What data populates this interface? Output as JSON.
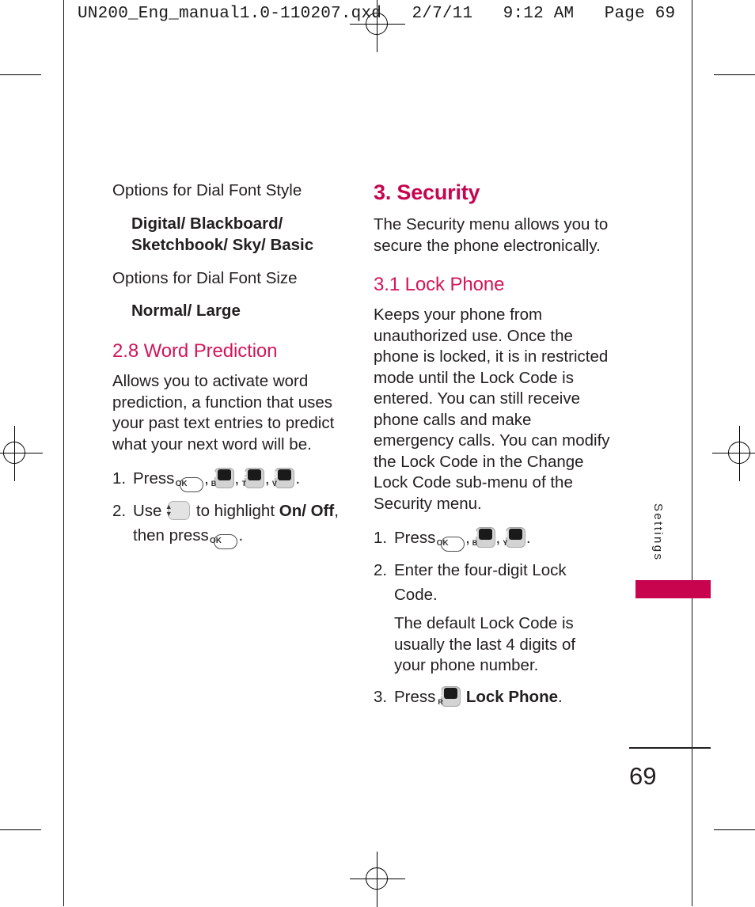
{
  "print_header": "UN200_Eng_manual1.0-110207.qxd   2/7/11   9:12 AM   Page 69",
  "colors": {
    "accent_crimson": "#c8044f",
    "heading_minor": "#d2165b",
    "body_text": "#231f20"
  },
  "left_column": {
    "dial_font_style_label": "Options for Dial Font Style",
    "dial_font_style_values": "Digital/ Blackboard/ Sketchbook/ Sky/ Basic",
    "dial_font_size_label": "Options for Dial Font Size",
    "dial_font_size_values": "Normal/ Large",
    "word_prediction_heading": "2.8 Word Prediction",
    "word_prediction_body": "Allows you to activate word prediction, a function that uses your past text entries to predict what your next word will be.",
    "steps": [
      {
        "number": "1.",
        "text_before": "Press",
        "keys": [
          {
            "type": "ok",
            "label": "OK"
          },
          {
            "type": "numeric",
            "digit": "9",
            "letter": "B"
          },
          {
            "type": "numeric",
            "digit": "2",
            "letter": "T"
          },
          {
            "type": "numeric",
            "digit": "8",
            "letter": "V"
          }
        ],
        "separators": [
          ",",
          ",",
          ",",
          "."
        ]
      },
      {
        "number": "2.",
        "text_before": "Use",
        "nav_key": "up-down",
        "text_middle": "to highlight",
        "bold_target": "On/ Off",
        "text_after": ", then press",
        "final_key": "OK",
        "text_end": "."
      }
    ]
  },
  "right_column": {
    "security_heading": "3. Security",
    "security_body": "The Security menu allows you to secure the phone electronically.",
    "lock_phone_heading": "3.1 Lock Phone",
    "lock_phone_body": "Keeps your phone from unauthorized use. Once the phone is locked, it is in restricted mode until the Lock Code is entered. You can still receive phone calls and make emergency calls. You can modify the Lock Code in the Change Lock Code sub-menu of the Security menu.",
    "steps": [
      {
        "number": "1.",
        "text_before": "Press",
        "keys": [
          {
            "type": "ok",
            "label": "OK"
          },
          {
            "type": "numeric",
            "digit": "9",
            "letter": "B"
          },
          {
            "type": "numeric",
            "digit": "3",
            "letter": "Y"
          }
        ]
      },
      {
        "number": "2.",
        "text": "Enter the four-digit Lock Code.",
        "note": "The default Lock Code is usually the last 4 digits of your phone number."
      },
      {
        "number": "3.",
        "text_before": "Press",
        "key": {
          "type": "numeric",
          "digit": "1",
          "letter": "R"
        },
        "bold_target": "Lock Phone",
        "text_end": "."
      }
    ]
  },
  "side_tab": {
    "label": "Settings"
  },
  "folio": {
    "page_number": "69"
  }
}
